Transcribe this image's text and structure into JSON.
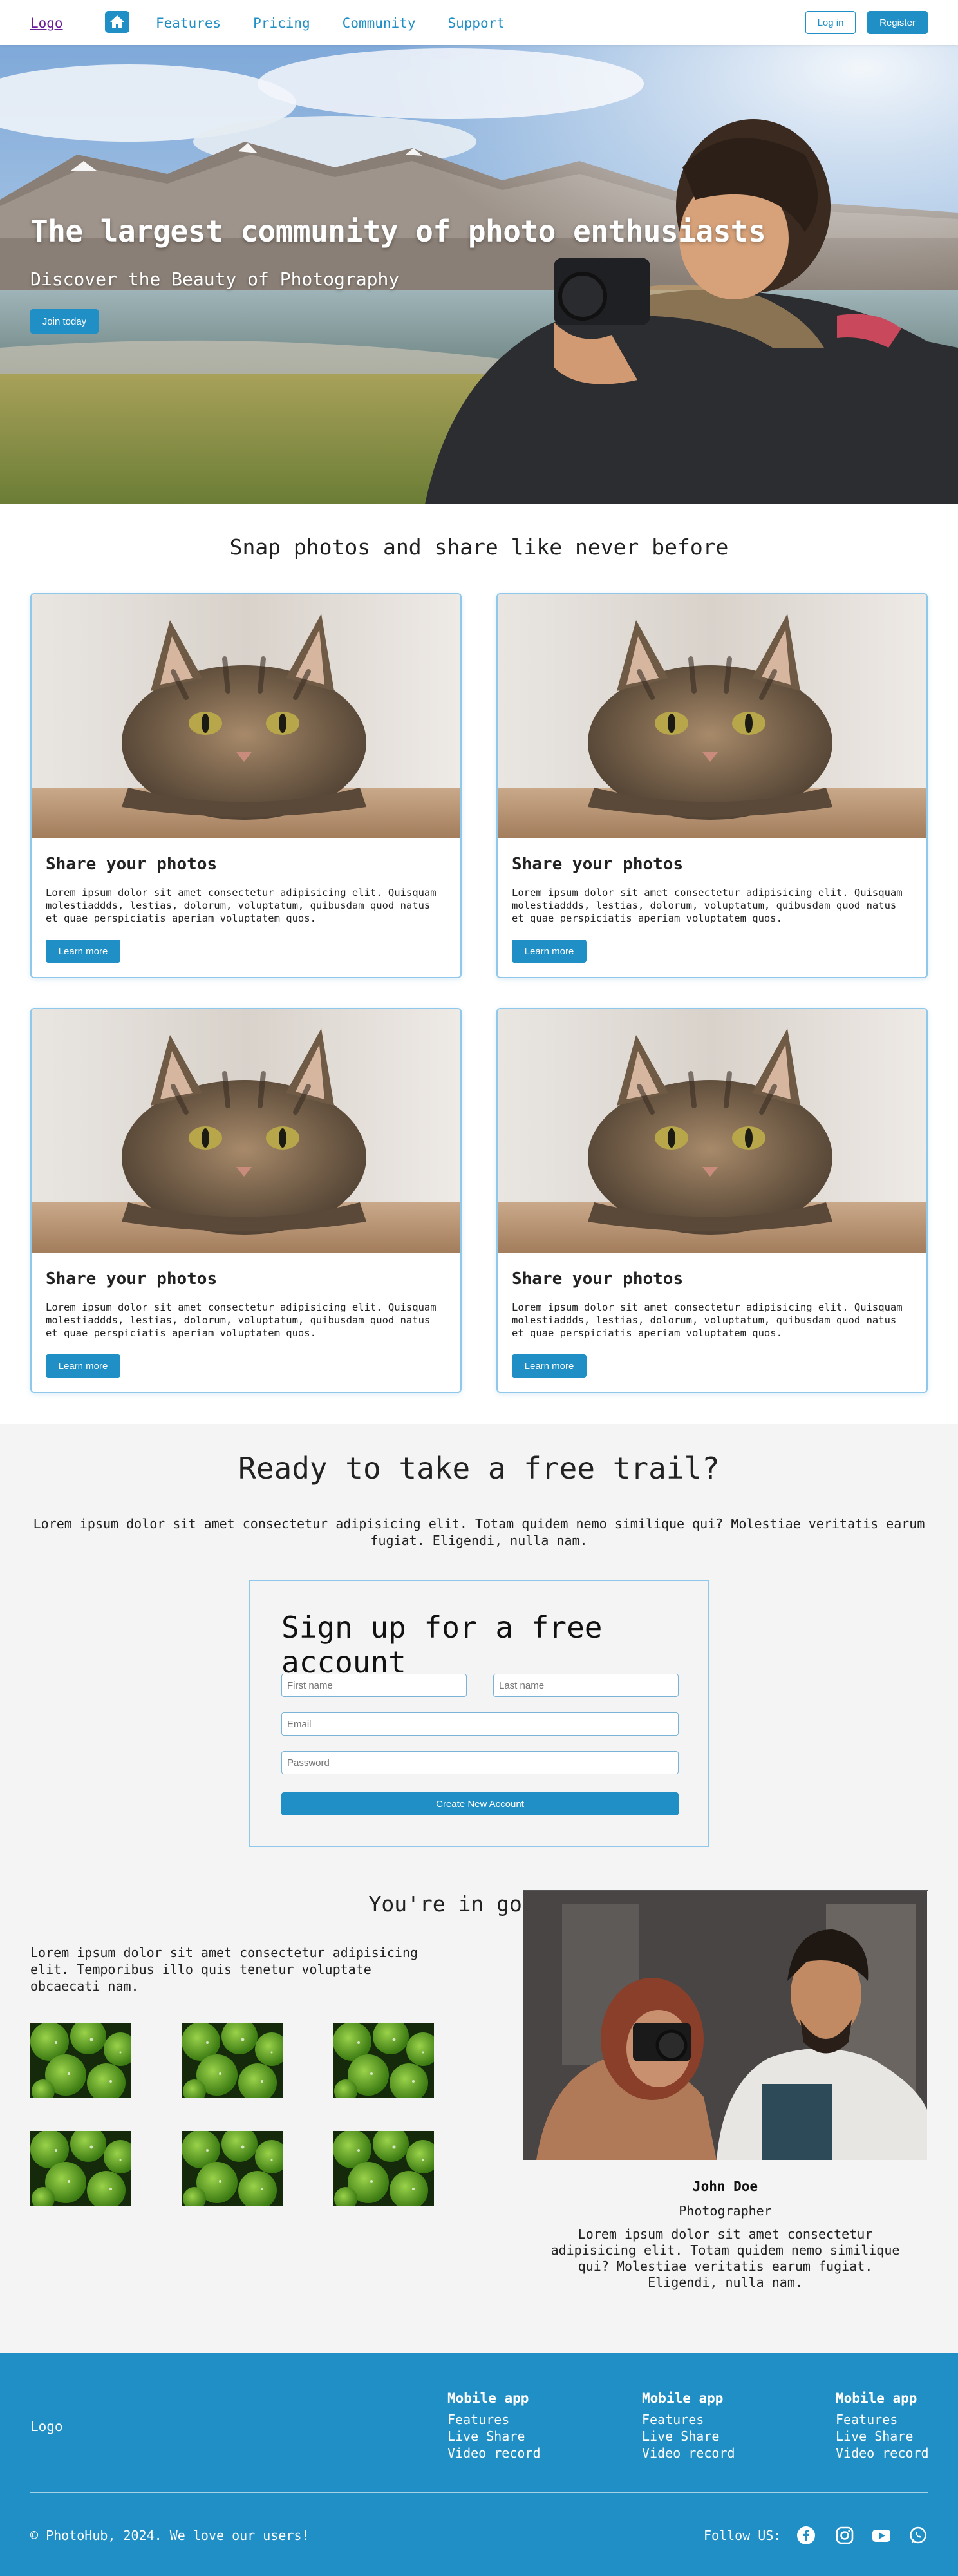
{
  "nav": {
    "logo": "Logo",
    "links": [
      "Features",
      "Pricing",
      "Community",
      "Support"
    ],
    "login": "Log in",
    "register": "Register"
  },
  "hero": {
    "title": "The largest community of photo enthusiasts",
    "subtitle": "Discover the Beauty of Photography",
    "cta": "Join today"
  },
  "features": {
    "title": "Snap photos and share like never before",
    "cards": [
      {
        "title": "Share your photos",
        "text": "Lorem ipsum dolor sit amet consectetur adipisicing elit. Quisquam molestiaddds, lestias, dolorum, voluptatum, quibusdam quod natus et quae perspiciatis aperiam voluptatem quos.",
        "button": "Learn more"
      },
      {
        "title": "Share your photos",
        "text": "Lorem ipsum dolor sit amet consectetur adipisicing elit. Quisquam molestiaddds, lestias, dolorum, voluptatum, quibusdam quod natus et quae perspiciatis aperiam voluptatem quos.",
        "button": "Learn more"
      },
      {
        "title": "Share your photos",
        "text": "Lorem ipsum dolor sit amet consectetur adipisicing elit. Quisquam molestiaddds, lestias, dolorum, voluptatum, quibusdam quod natus et quae perspiciatis aperiam voluptatem quos.",
        "button": "Learn more"
      },
      {
        "title": "Share your photos",
        "text": "Lorem ipsum dolor sit amet consectetur adipisicing elit. Quisquam molestiaddds, lestias, dolorum, voluptatum, quibusdam quod natus et quae perspiciatis aperiam voluptatem quos.",
        "button": "Learn more"
      }
    ]
  },
  "trial": {
    "title": "Ready to take a free trail?",
    "text": "Lorem ipsum dolor sit amet consectetur adipisicing elit. Totam quidem nemo similique qui? Molestiae veritatis earum fugiat. Eligendi, nulla nam.",
    "form": {
      "title": "Sign up for a free account",
      "first_name": "First name",
      "last_name": "Last name",
      "email": "Email",
      "password": "Password",
      "submit": "Create New Account"
    }
  },
  "company": {
    "title": "You're in good compnay",
    "text": "Lorem ipsum dolor sit amet consectetur adipisicing elit. Temporibus illo quis tenetur voluptate obcaecati nam.",
    "profile": {
      "name": "John Doe",
      "role": "Photographer",
      "bio": "Lorem ipsum dolor sit amet consectetur adipisicing elit. Totam quidem nemo similique qui? Molestiae veritatis earum fugiat. Eligendi, nulla nam."
    }
  },
  "footer": {
    "logo": "Logo",
    "columns": [
      {
        "title": "Mobile app",
        "items": [
          "Features",
          "Live Share",
          "Video record"
        ]
      },
      {
        "title": "Mobile app",
        "items": [
          "Features",
          "Live Share",
          "Video record"
        ]
      },
      {
        "title": "Mobile app",
        "items": [
          "Features",
          "Live Share",
          "Video record"
        ]
      }
    ],
    "copyright": "© PhotoHub, 2024. We love our users!",
    "follow": "Follow US:",
    "social_icons": [
      "facebook-icon",
      "instagram-icon",
      "youtube-icon",
      "whatsapp-icon"
    ]
  },
  "colors": {
    "accent": "#1f8fc6",
    "section_bg": "#f4f4f4"
  }
}
